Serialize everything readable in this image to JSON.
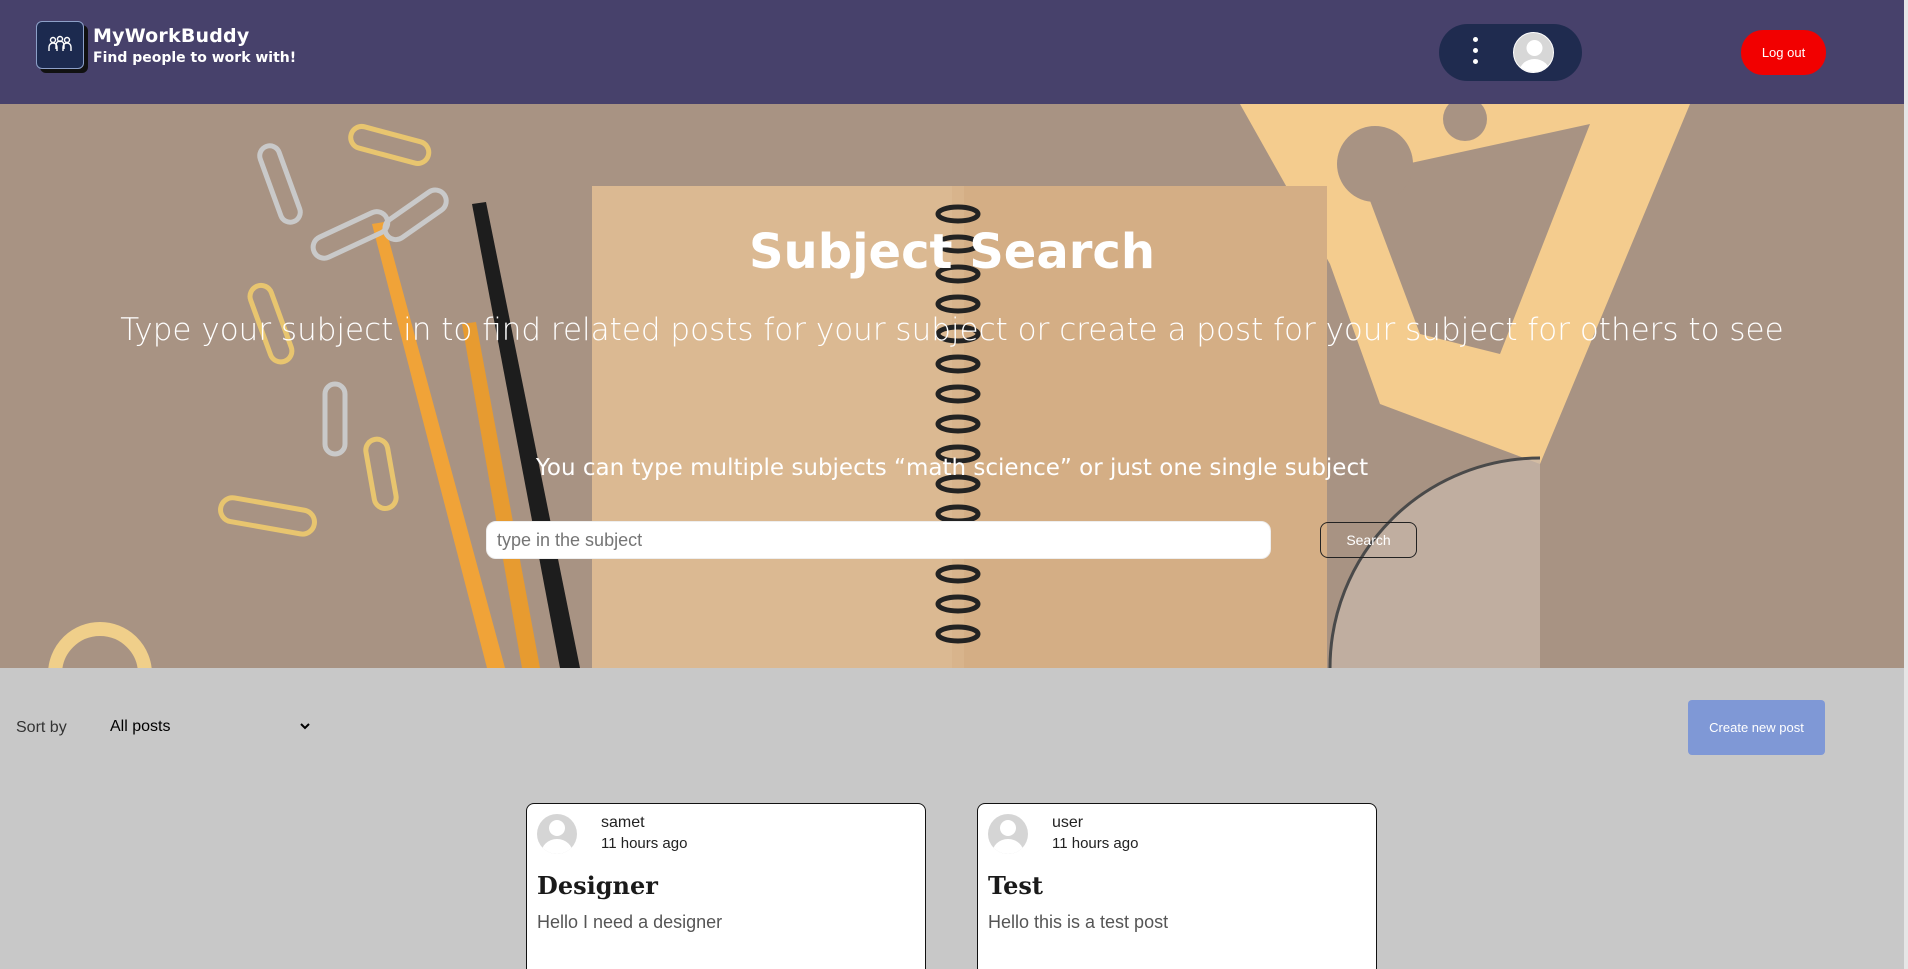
{
  "header": {
    "brand_title": "MyWorkBuddy",
    "brand_tagline": "Find people to work with!",
    "logout_label": "Log out",
    "colors": {
      "bar": "#47416b",
      "logout": "#f20000",
      "pill": "#1f2b4f"
    }
  },
  "hero": {
    "title": "Subject Search",
    "subtitle": "Type your subject in to find related posts for your subject or create a post for your subject for others to see",
    "hint": "You can type multiple subjects “math science” or just one single subject",
    "search_placeholder": "type in the subject",
    "search_value": "",
    "search_button": "Search"
  },
  "toolbar": {
    "sort_label": "Sort by",
    "sort_selected": "All posts",
    "create_label": "Create new post",
    "create_color": "#7f98d6"
  },
  "posts": [
    {
      "author": "samet",
      "time": "11 hours ago",
      "title": "Designer",
      "body": "Hello I need a designer"
    },
    {
      "author": "user",
      "time": "11 hours ago",
      "title": "Test",
      "body": "Hello this is a test post"
    }
  ]
}
